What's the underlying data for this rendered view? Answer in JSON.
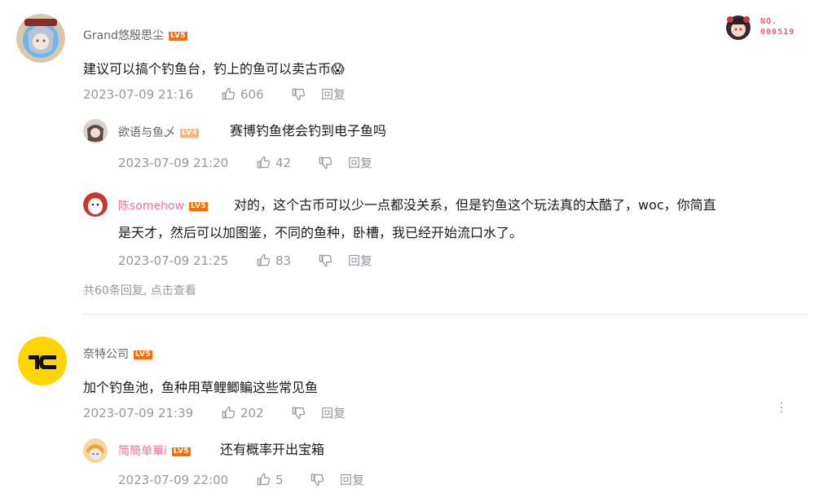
{
  "badge": {
    "no_label": "NO.",
    "number": "000519"
  },
  "comments": [
    {
      "username": "Grand悠殷思尘",
      "level": "LV5",
      "content": "建议可以搞个钓鱼台，钓上的鱼可以卖古币😱",
      "time": "2023-07-09 21:16",
      "likes": "606",
      "reply_label": "回复",
      "replies": [
        {
          "username": "欲语与鱼乄",
          "level": "LV4",
          "content": "赛博钓鱼佬会钓到电子鱼吗",
          "time": "2023-07-09 21:20",
          "likes": "42",
          "reply_label": "回复"
        },
        {
          "username": "陈somehow",
          "level": "LV5",
          "content_line1": "对的，这个古币可以少一点都没关系，但是钓鱼这个玩法真的太酷了，woc，你简直",
          "content_line2": "是天才，然后可以加图鉴，不同的鱼种，卧槽，我已经开始流口水了。",
          "time": "2023-07-09 21:25",
          "likes": "83",
          "reply_label": "回复"
        }
      ],
      "more_replies": "共60条回复, 点击查看"
    },
    {
      "username": "奈特公司",
      "level": "LV5",
      "content": "加个钓鱼池，鱼种用草鲤鲫鳊这些常见鱼",
      "time": "2023-07-09 21:39",
      "likes": "202",
      "reply_label": "回复",
      "more_icon": "⋮",
      "replies": [
        {
          "username": "简簡单單i",
          "level": "LV5",
          "content": "还有概率开出宝箱",
          "time": "2023-07-09 22:00",
          "likes": "5",
          "reply_label": "回复"
        }
      ]
    }
  ],
  "colors": {
    "vip_pink": "#fb7299",
    "level5": "#ff6c00",
    "level4": "#ffb37c",
    "meta": "#9499a0"
  }
}
